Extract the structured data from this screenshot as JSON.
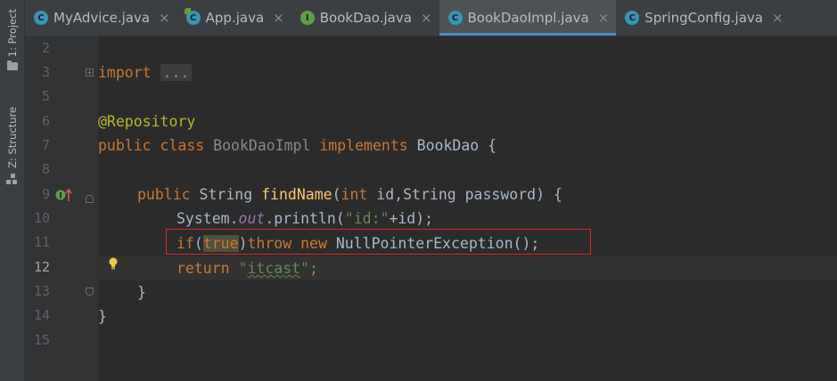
{
  "sidebar": {
    "project_label": "1: Project",
    "structure_label": "Z: Structure"
  },
  "tabs": [
    {
      "label": "MyAdvice.java",
      "icon": "class-icon",
      "active": false
    },
    {
      "label": "App.java",
      "icon": "spring-class-icon",
      "active": false
    },
    {
      "label": "BookDao.java",
      "icon": "interface-icon",
      "active": false
    },
    {
      "label": "BookDaoImpl.java",
      "icon": "class-icon",
      "active": true
    },
    {
      "label": "SpringConfig.java",
      "icon": "class-icon",
      "active": false
    }
  ],
  "tab_close_glyph": "×",
  "icon_letters": {
    "class": "C",
    "interface": "I"
  },
  "gutter": {
    "line_numbers": [
      "2",
      "3",
      "5",
      "6",
      "7",
      "8",
      "9",
      "10",
      "11",
      "12",
      "13",
      "14",
      "15"
    ],
    "current_line": "12"
  },
  "code": {
    "l3": {
      "kw": "import",
      "dots": "..."
    },
    "l6": {
      "ann": "@Repository"
    },
    "l7": {
      "kw1": "public",
      "kw2": "class",
      "name": "BookDaoImpl",
      "kw3": "implements",
      "iface": "BookDao",
      "brace": " {"
    },
    "l9": {
      "kw1": "public",
      "type": "String",
      "fn": "findName",
      "p1": "(",
      "kw2": "int",
      "p2": " id,",
      "type2": "String",
      "p3": " password) {"
    },
    "l10": {
      "a": "System.",
      "out": "out",
      "b": ".println(",
      "str": "\"id:\"",
      "c": "+id);"
    },
    "l11": {
      "if": "if",
      "p": "(",
      "true": "true",
      "p2": ")",
      "throw": "throw",
      "new": "new",
      "rest": " NullPointerException();"
    },
    "l12": {
      "kw": "return",
      "q1": "\"",
      "s": "itcast",
      "q2": "\"",
      "semi": ";"
    },
    "l13": {
      "brace": "}"
    },
    "l14": {
      "brace": "}"
    }
  },
  "colors": {
    "editor_bg": "#2b2b2b",
    "keyword": "#cc7832",
    "annotation": "#bbb529",
    "string": "#6a8759",
    "method": "#ffc66d",
    "static_field": "#9876aa",
    "highlight_box": "#d42b2b",
    "active_tab_underline": "#4a88c7"
  }
}
